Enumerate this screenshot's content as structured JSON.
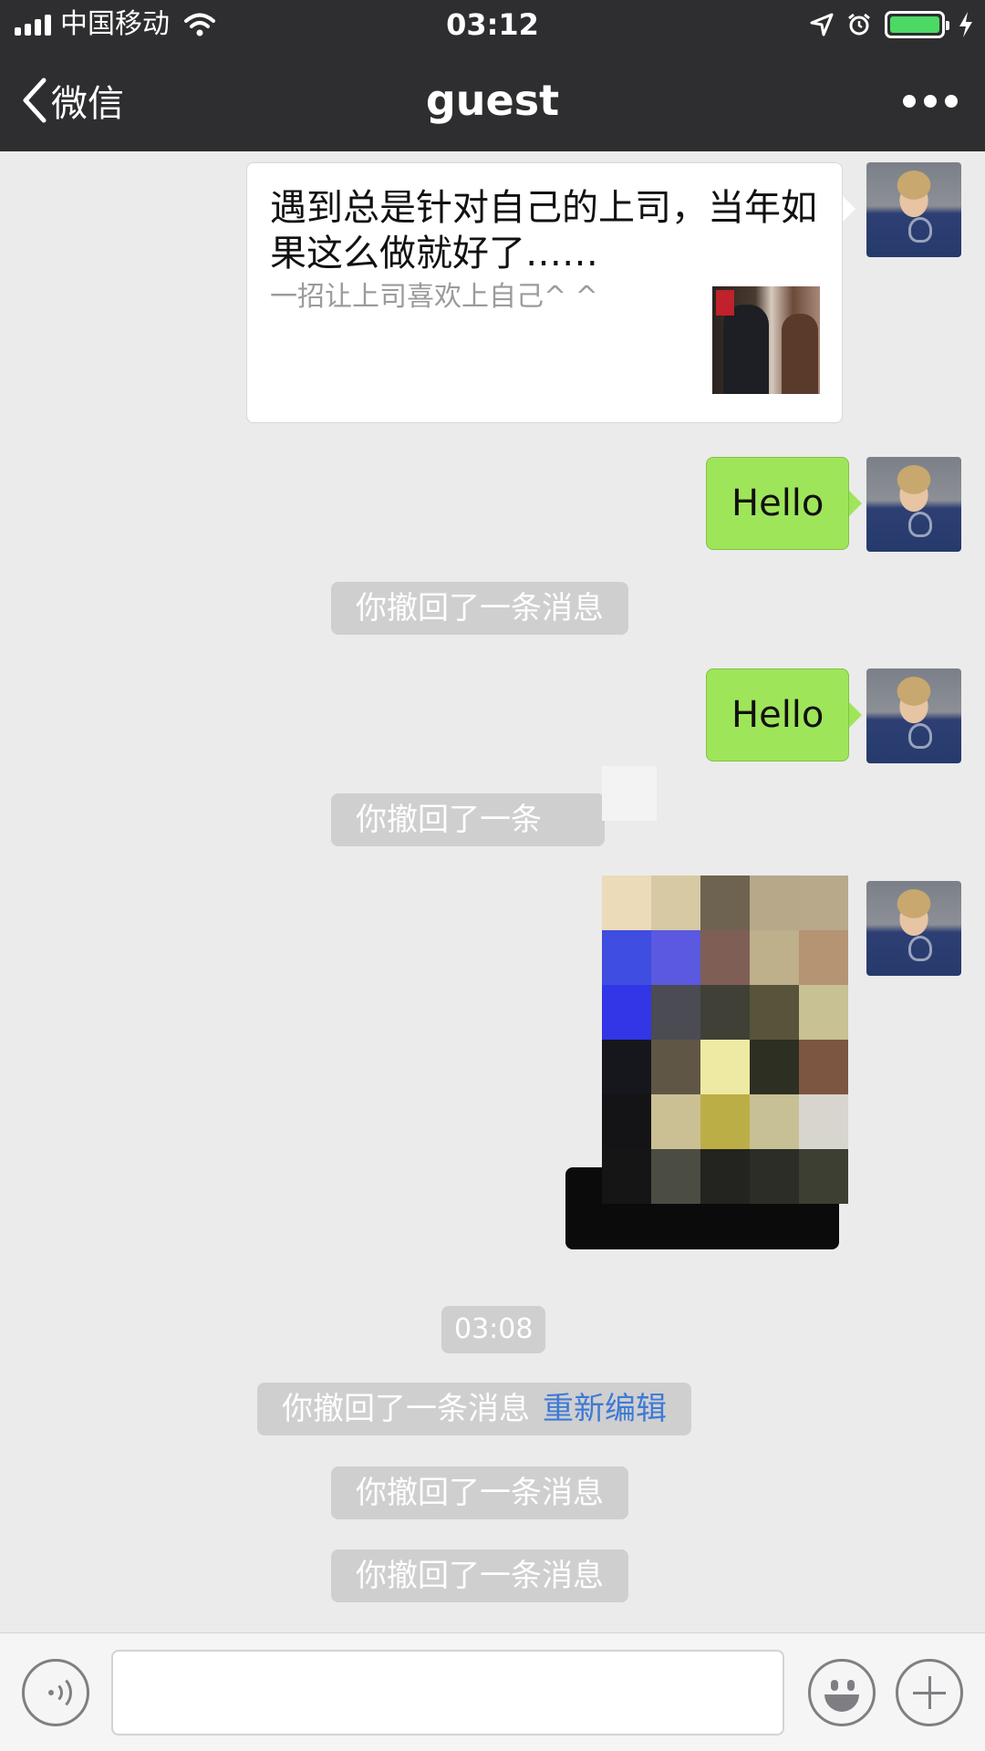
{
  "status_bar": {
    "carrier": "中国移动",
    "time": "03:12",
    "battery_color": "#4cd964"
  },
  "nav": {
    "back_label": "微信",
    "title": "guest",
    "more_icon": "more-icon"
  },
  "messages": {
    "link_card": {
      "title": "遇到总是针对自己的上司，当年如果这么做就好了……",
      "desc": "一招让上司喜欢上自己^ ^",
      "thumb_seal_color": "#c0212a"
    },
    "hello_1": "Hello",
    "recall_1": "你撤回了一条消息",
    "hello_2": "Hello",
    "recall_2_fragment": "你撤回了一条",
    "pixelated_image_colors": [
      [
        "#ecdbb8",
        "#d7c9a3",
        "#6e6350",
        "#b7a88a",
        "#b8a98b"
      ],
      [
        "#3f4de0",
        "#5a59e0",
        "#7f5e56",
        "#beb08a",
        "#b59473"
      ],
      [
        "#3236e6",
        "#4a4b53",
        "#414036",
        "#58543b",
        "#c8c193"
      ],
      [
        "#16171c",
        "#5f5646",
        "#eeeaa3",
        "#2c2f22",
        "#7d5641"
      ],
      [
        "#141416",
        "#cbc094",
        "#bcae47",
        "#c6c094",
        "#d8d5cf"
      ],
      [
        "#151515",
        "#4b4c42",
        "#23241f",
        "#2b2d26",
        "#3e3f33"
      ]
    ],
    "timestamp": "03:08",
    "recall_3": "你撤回了一条消息",
    "reedit": "重新编辑",
    "recall_4": "你撤回了一条消息",
    "recall_5": "你撤回了一条消息"
  },
  "input_bar": {
    "placeholder": "",
    "voice_icon": "voice-icon",
    "emoji_icon": "emoji-icon",
    "plus_icon": "plus-icon"
  }
}
